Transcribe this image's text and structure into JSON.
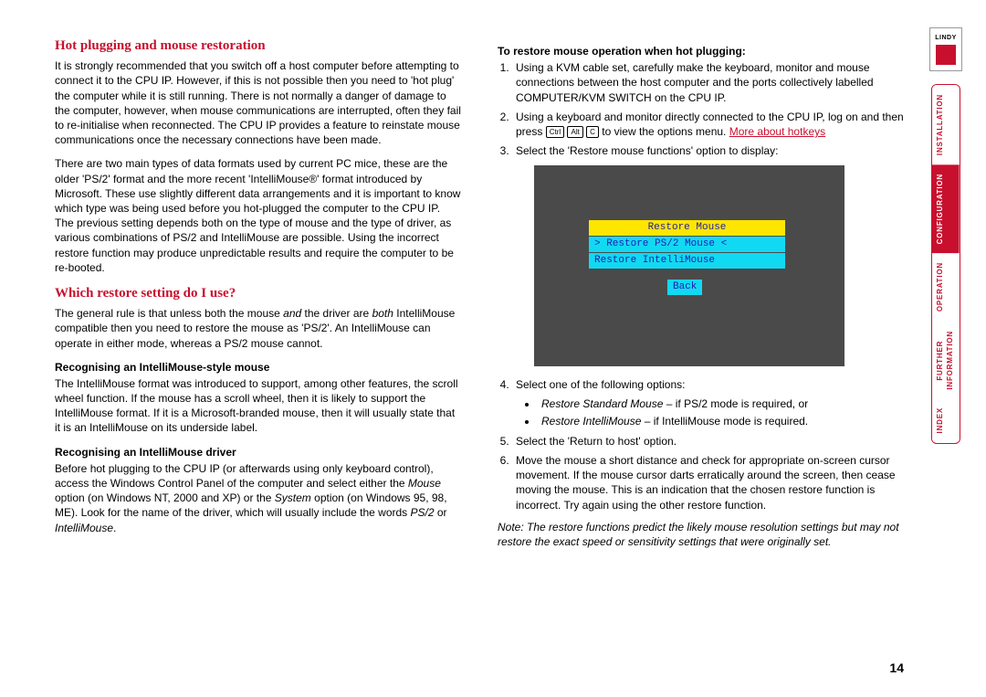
{
  "left": {
    "h1": "Hot plugging and mouse restoration",
    "p1": "It is strongly recommended that you switch off a host computer before attempting to connect it to the CPU IP. However, if this is not possible then you need to 'hot plug' the computer while it is still running. There is not normally a danger of damage to the computer, however, when mouse communications are interrupted, often they fail to re-initialise when reconnected. The CPU IP provides a feature to reinstate mouse communications once the necessary connections have been made.",
    "p2": "There are two main types of data formats used by current PC mice, these are the older 'PS/2' format and the more recent 'IntelliMouse®' format introduced by Microsoft. These use slightly different data arrangements and it is important to know which type was being used before you hot-plugged the computer to the CPU IP. The previous setting depends both on the type of mouse and the type of driver, as various combinations of PS/2 and IntelliMouse are possible. Using the incorrect restore function may produce unpredictable results and require the computer to be re-booted.",
    "h2": "Which restore setting do I use?",
    "p3a": "The general rule is that unless both the mouse ",
    "p3b": "and",
    "p3c": " the driver are ",
    "p3d": "both",
    "p3e": " IntelliMouse compatible then you need to restore the mouse as 'PS/2'. An IntelliMouse can operate in either mode, whereas a PS/2 mouse cannot.",
    "sub1": "Recognising an IntelliMouse-style mouse",
    "p4": "The IntelliMouse format was introduced to support, among other features, the scroll wheel function. If the mouse has a scroll wheel, then it is likely to support the IntelliMouse format. If it is a Microsoft-branded mouse, then it will usually state that it is an IntelliMouse on its underside label.",
    "sub2": "Recognising an IntelliMouse driver",
    "p5a": "Before hot plugging to the CPU IP (or afterwards using only keyboard control), access the Windows Control Panel of the computer and select either the ",
    "p5b": "Mouse",
    "p5c": " option (on Windows NT, 2000 and XP) or the ",
    "p5d": "System",
    "p5e": " option (on Windows 95, 98, ME). Look for the name of the driver, which will usually include the words ",
    "p5f": "PS/2",
    "p5g": " or ",
    "p5h": "IntelliMouse",
    "p5i": "."
  },
  "right": {
    "head": "To restore mouse operation when hot plugging:",
    "s1": "Using a KVM cable set, carefully make the keyboard, monitor and mouse connections between the host computer and the ports collectively labelled COMPUTER/KVM SWITCH on the CPU IP.",
    "s2a": "Using a keyboard and monitor directly connected to the CPU IP, log on and then press ",
    "s2b": " to view the options menu. ",
    "s2link": "More about hotkeys",
    "k1": "Ctrl",
    "k2": "Alt",
    "k3": "C",
    "s3": "Select the 'Restore mouse functions' option to display:",
    "menu": {
      "title": "Restore Mouse",
      "i1": "> Restore PS/2 Mouse  <",
      "i2": "  Restore IntelliMouse",
      "back": "Back"
    },
    "s4": "Select one of the following options:",
    "b1a": "Restore Standard Mouse",
    "b1b": " – if PS/2 mode is required, or",
    "b2a": "Restore IntelliMouse",
    "b2b": " – if IntelliMouse mode is required.",
    "s5": "Select the 'Return to host' option.",
    "s6": "Move the mouse a short distance and check for appropriate on-screen cursor movement. If the mouse cursor darts erratically around the screen, then cease moving the mouse. This is an indication that the chosen restore function is incorrect. Try again using the other restore function.",
    "note": "Note: The restore functions predict the likely mouse resolution settings but may not restore the exact speed or sensitivity settings that were originally set."
  },
  "nav": {
    "logo": "LINDY",
    "items": [
      "INSTALLATION",
      "CONFIGURATION",
      "OPERATION",
      "FURTHER\nINFORMATION",
      "INDEX"
    ]
  },
  "page": "14"
}
